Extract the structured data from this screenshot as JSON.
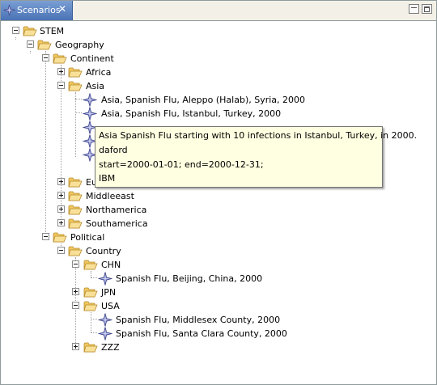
{
  "view": {
    "tab_title": "Scenarios",
    "tab_icon": "scenario-star-icon",
    "close_icon": "close-x-icon",
    "minimize_icon": "minimize-icon",
    "maximize_icon": "maximize-icon"
  },
  "tree": {
    "stem": "STEM",
    "geography": "Geography",
    "continent": "Continent",
    "africa": "Africa",
    "asia": "Asia",
    "asia_children": [
      "Asia, Spanish Flu,  Aleppo (Halab), Syria, 2000",
      "Asia, Spanish Flu,  Istanbul, Turkey, 2000",
      "",
      "",
      ""
    ],
    "europe_partial": "Eu",
    "middleeast": "Middleeast",
    "northamerica": "Northamerica",
    "southamerica": "Southamerica",
    "political": "Political",
    "country": "Country",
    "chn": "CHN",
    "chn_child": "Spanish Flu, Beijing, China, 2000",
    "jpn": "JPN",
    "usa": "USA",
    "usa_children": [
      "Spanish Flu, Middlesex County, 2000",
      "Spanish Flu, Santa Clara County, 2000"
    ],
    "zzz": "ZZZ",
    "folder_icon": "folder-open-icon",
    "scenario_icon": "scenario-star-icon"
  },
  "tooltip": {
    "description": "Asia Spanish Flu starting with 10 infections in  Istanbul, Turkey, in 2000.",
    "creator": "daford",
    "valid": "start=2000-01-01; end=2000-12-31;",
    "rights": "IBM"
  },
  "colors": {
    "tab_active": "#4a72b5",
    "tooltip_bg": "#ffffe1",
    "folder": "#f5d478",
    "scenario_star": "#7a85c4"
  }
}
